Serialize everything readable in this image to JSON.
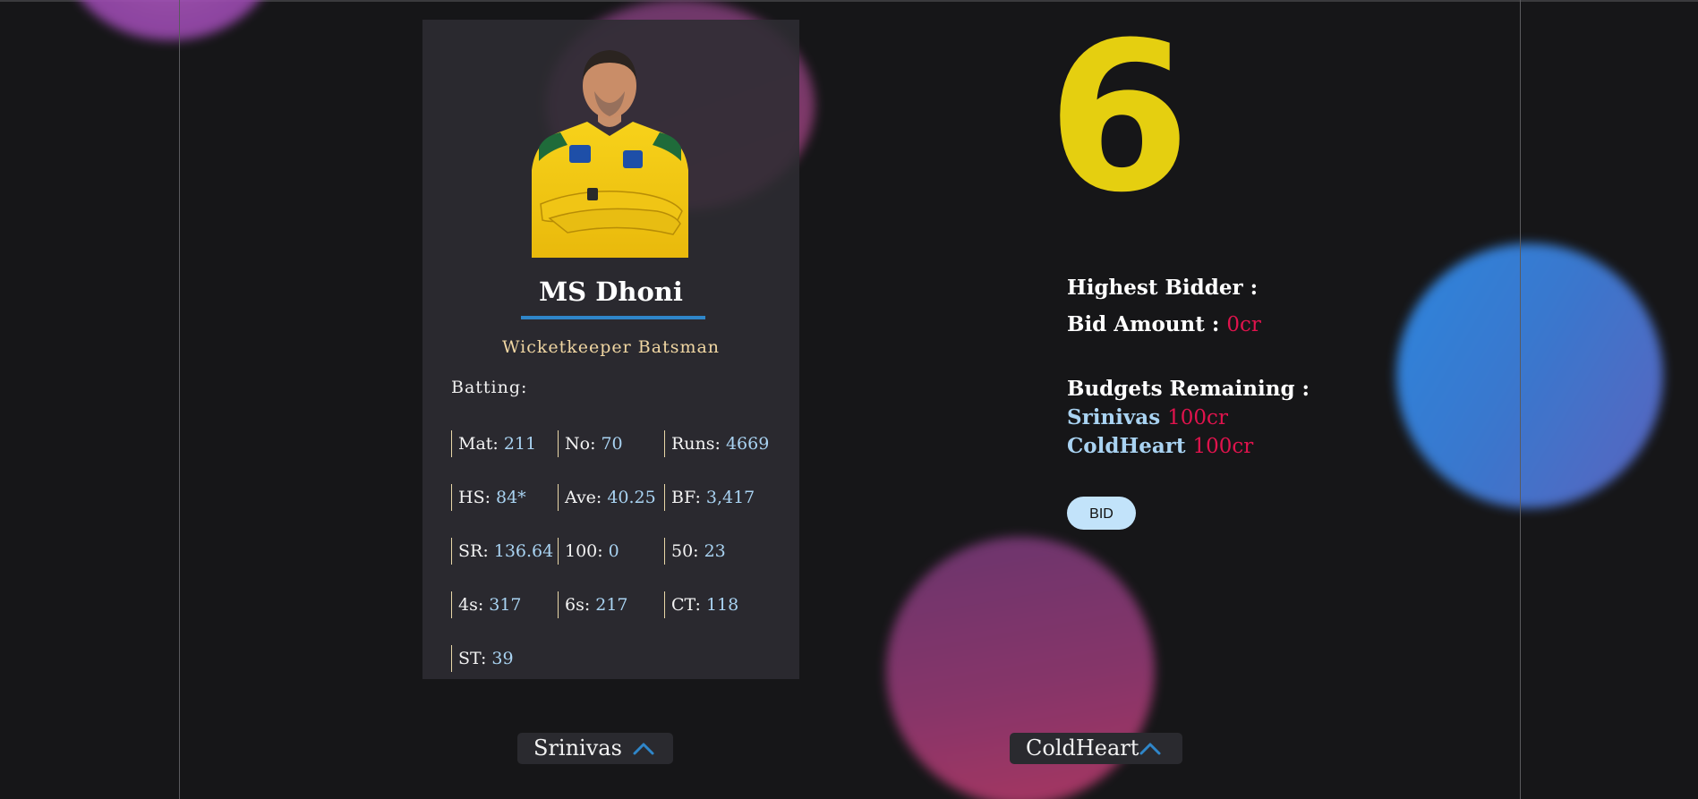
{
  "player": {
    "name": "MS Dhoni",
    "role": "Wicketkeeper Batsman",
    "batting_label": "Batting:",
    "stats": [
      {
        "key": "Mat:",
        "value": "211"
      },
      {
        "key": "No:",
        "value": "70"
      },
      {
        "key": "Runs:",
        "value": "4669"
      },
      {
        "key": "HS:",
        "value": "84*"
      },
      {
        "key": "Ave:",
        "value": "40.25"
      },
      {
        "key": "BF:",
        "value": "3,417"
      },
      {
        "key": "SR:",
        "value": "136.64"
      },
      {
        "key": "100:",
        "value": "0"
      },
      {
        "key": "50:",
        "value": "23"
      },
      {
        "key": "4s:",
        "value": "317"
      },
      {
        "key": "6s:",
        "value": "217"
      },
      {
        "key": "CT:",
        "value": "118"
      },
      {
        "key": "ST:",
        "value": "39"
      }
    ]
  },
  "timer": "6",
  "auction": {
    "highest_bidder_label": "Highest Bidder :",
    "highest_bidder_value": "",
    "bid_amount_label": "Bid Amount :",
    "bid_amount_value": "0cr",
    "budgets_label": "Budgets Remaining :",
    "budgets": [
      {
        "team": "Srinivas",
        "amount": "100cr"
      },
      {
        "team": "ColdHeart",
        "amount": "100cr"
      }
    ],
    "bid_button": "BID"
  },
  "teams": [
    {
      "name": "Srinivas",
      "icon": "chevron-up-icon"
    },
    {
      "name": "ColdHeart",
      "icon": "chevron-up-icon"
    }
  ],
  "colors": {
    "background": "#161618",
    "timer": "#e5cf10",
    "amount_red": "#e0134d",
    "stat_value": "#a9d3f2",
    "accent_blue": "#2f86c9"
  }
}
